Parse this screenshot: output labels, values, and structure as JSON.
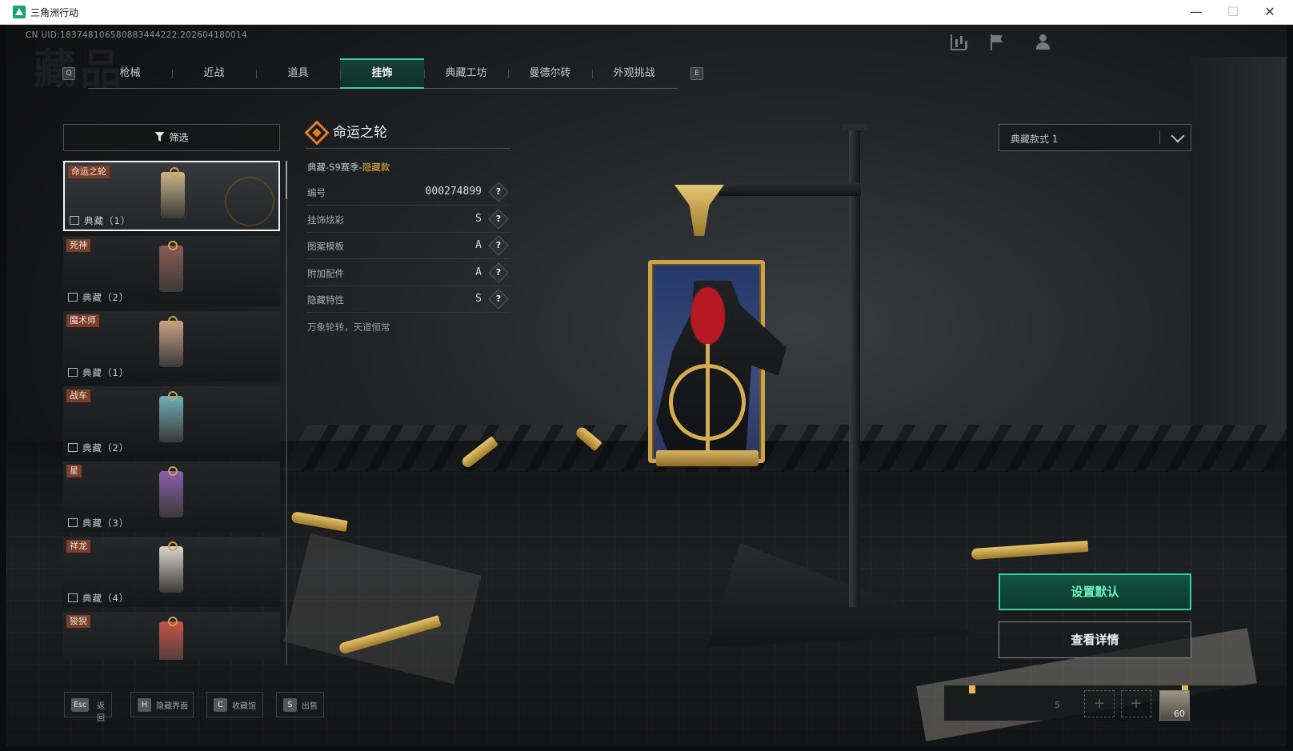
{
  "window": {
    "title": "三角洲行动",
    "controls": {
      "minimize": "—",
      "maximize": "☐",
      "close": "✕"
    }
  },
  "header": {
    "uid": "CN UID:1837481065808834442​22,202604180014",
    "watermark": "藏品",
    "prev_key": "Q",
    "next_key": "E",
    "tabs": [
      {
        "label": "枪械",
        "active": false
      },
      {
        "label": "近战",
        "active": false
      },
      {
        "label": "道具",
        "active": false
      },
      {
        "label": "挂饰",
        "active": true
      },
      {
        "label": "典藏工坊",
        "active": false
      },
      {
        "label": "曼德尔砖",
        "active": false
      },
      {
        "label": "外观挑战",
        "active": false
      }
    ]
  },
  "filter": {
    "label": "筛选"
  },
  "items": [
    {
      "name": "命运之轮",
      "count": "典藏（1）",
      "selected": true,
      "thumb_color": "#c9b48a"
    },
    {
      "name": "死神",
      "count": "典藏（2）",
      "selected": false,
      "thumb_color": "#8c5a55"
    },
    {
      "name": "魔术师",
      "count": "典藏（1）",
      "selected": false,
      "thumb_color": "#c9a18a"
    },
    {
      "name": "战车",
      "count": "典藏（2）",
      "selected": false,
      "thumb_color": "#6fb0b8"
    },
    {
      "name": "星",
      "count": "典藏（3）",
      "selected": false,
      "thumb_color": "#8a5fb0"
    },
    {
      "name": "祥龙",
      "count": "典藏（4）",
      "selected": false,
      "thumb_color": "#d9d6cf"
    },
    {
      "name": "狻猊",
      "count": "",
      "selected": false,
      "thumb_color": "#c8554a"
    }
  ],
  "detail": {
    "title": "命运之轮",
    "series_prefix": "典藏-S9赛季-",
    "series_hidden": "隐藏款",
    "attributes": [
      {
        "label": "编号",
        "value": "000274899",
        "help": "?"
      },
      {
        "label": "挂饰炫彩",
        "value": "S",
        "help": "?"
      },
      {
        "label": "图案模板",
        "value": "A",
        "help": "?"
      },
      {
        "label": "附加配件",
        "value": "A",
        "help": "?"
      },
      {
        "label": "隐藏特性",
        "value": "S",
        "help": "?"
      }
    ],
    "description": "万象轮转，天道恒常"
  },
  "variant_select": {
    "value": "典藏款式 1"
  },
  "actions": {
    "set_default": "设置默认",
    "view_details": "查看详情"
  },
  "hints": [
    {
      "key": "Esc",
      "label": "返回"
    },
    {
      "key": "H",
      "label": "隐藏界面"
    },
    {
      "key": "C",
      "label": "收藏馆"
    },
    {
      "key": "S",
      "label": "出售"
    }
  ],
  "tray": {
    "people_count": "5",
    "slot_symbol": "+",
    "level": "60"
  },
  "colors": {
    "accent_green": "#2fd29d",
    "hidden_gold": "#e4b84c",
    "name_tag": "#7a3f2b"
  },
  "icons": {
    "filter": "filter-funnel-icon",
    "detail": "diamond-emblem-icon",
    "help": "question-diamond-icon",
    "count": "collection-image-icon",
    "chevron": "chevron-down-icon",
    "stats": "bar-chart-icon",
    "flag": "flag-icon",
    "people": "people-icon"
  }
}
